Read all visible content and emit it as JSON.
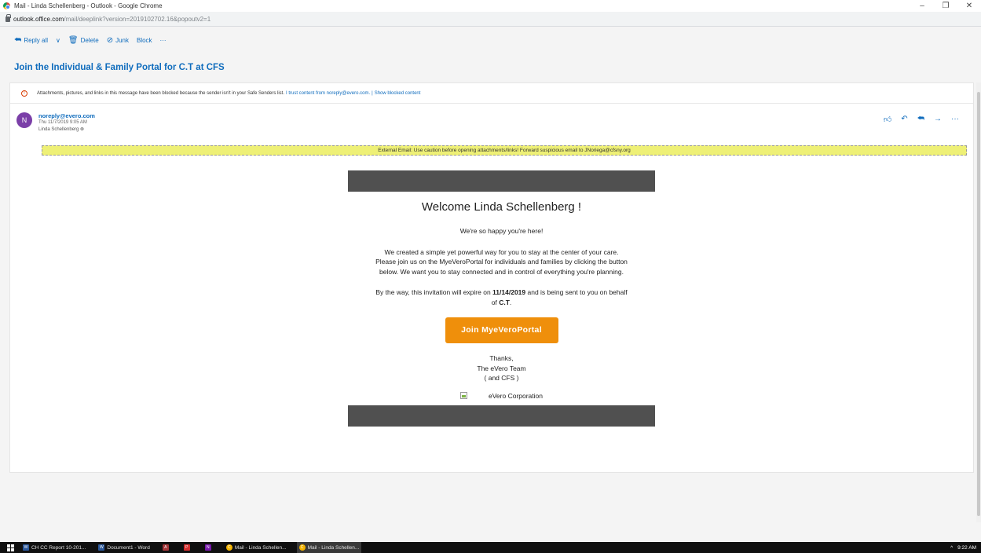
{
  "window": {
    "title": "Mail - Linda Schellenberg - Outlook - Google Chrome",
    "minimize": "–",
    "restore": "❐",
    "close": "✕"
  },
  "address": {
    "domain": "outlook.office.com",
    "path": "/mail/deeplink?version=2019102702.16&popoutv2=1"
  },
  "toolbar": {
    "reply_all": "Reply all",
    "chevron": "∨",
    "delete": "Delete",
    "junk": "Junk",
    "block": "Block",
    "more": "···"
  },
  "message": {
    "subject": "Join the Individual & Family Portal for C.T at CFS",
    "blocked_notice": "Attachments, pictures, and links in this message have been blocked because the sender isn't in your Safe Senders list.",
    "trust_link": "I trust content from noreply@evero.com.",
    "separator": "|",
    "show_blocked_link": "Show blocked content",
    "sender_initial": "N",
    "sender_email": "noreply@evero.com",
    "date": "Thu 11/7/2019 9:05 AM",
    "to": "Linda Schellenberg ⊗",
    "external_banner": "External Email: Use caution before opening attachments/links! Forward suspicious email to JNoriega@cfsny.org"
  },
  "body": {
    "welcome": "Welcome Linda Schellenberg !",
    "happy": "We're so happy you're here!",
    "para1": "We created a simple yet powerful way for you to stay at the center of your care. Please join us on the MyeVeroPortal for individuals and families by clicking the button below. We want you to stay connected and in control of everything you're planning.",
    "para2_prefix": "By the way, this invitation will expire on ",
    "expire_date": "11/14/2019",
    "para2_mid": " and is being sent to you on behalf of ",
    "behalf_of": "C.T",
    "para2_suffix": ".",
    "join_button": "Join MyeVeroPortal",
    "thanks": "Thanks,",
    "team": "The eVero Team",
    "cfs": "( and CFS )",
    "corp": "eVero Corporation"
  },
  "taskbar": {
    "items": [
      {
        "label": "CH CC Report 10-201...",
        "app": "W"
      },
      {
        "label": "Document1 - Word",
        "app": "W"
      },
      {
        "label": "",
        "app": "A"
      },
      {
        "label": "",
        "app": "P"
      },
      {
        "label": "",
        "app": "N"
      },
      {
        "label": "Mail - Linda Schellen...",
        "app": "C"
      },
      {
        "label": "Mail - Linda Schellen...",
        "app": "C"
      }
    ],
    "tray_caret": "^",
    "time": "9:22 AM"
  },
  "colors": {
    "accent": "#0f6cbd",
    "avatar": "#7b3fa8",
    "join_button": "#ef8f0b",
    "banner": "#eef076",
    "dark_bar": "#505050"
  }
}
